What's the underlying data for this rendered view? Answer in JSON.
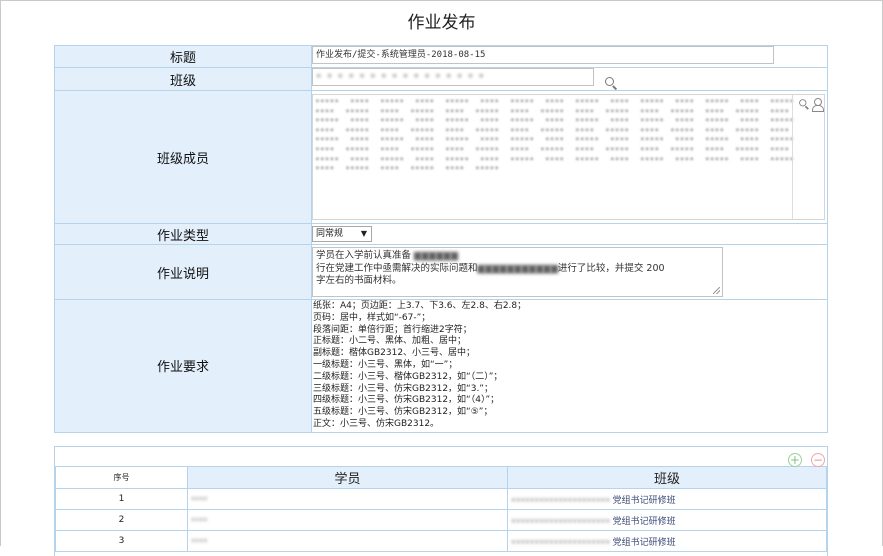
{
  "page": {
    "title": "作业发布"
  },
  "form": {
    "title_label": "标题",
    "title_value": "作业发布/提交-系统管理员-2018-08-15",
    "class_label": "班级",
    "class_value": "• • • • • • • • • • • • • • • •",
    "members_label": "班级成员",
    "members_value": "••••• •••• ••••• •••• ••••• •••• ••••• •••• ••••• •••• ••••• •••• ••••• •••• ••••• •••• ••••• •••• ••••• •••• ••••• •••• ••••• •••• ••••• •••• ••••• •••• ••••• •••• ••••• •••• ••••• •••• ••••• •••• ••••• •••• ••••• •••• ••••• •••• ••••• •••• ••••• •••• ••••• •••• ••••• •••• ••••• •••• ••••• •••• ••••• •••• ••••• •••• ••••• •••• ••••• •••• ••••• •••• ••••• •••• ••••• •••• ••••• •••• ••••• •••• ••••• •••• ••••• •••• ••••• •••• ••••• •••• ••••• •••• ••••• •••• ••••• •••• ••••• •••• ••••• •••• ••••• •••• ••••• •••• ••••• •••• ••••• •••• ••••• •••• ••••• •••• ••••• •••• ••••• •••• ••••• •••• ••••• •••• •••••",
    "type_label": "作业类型",
    "type_value": "同常规",
    "desc_label": "作业说明",
    "desc_line1": "学员在入学前认真准备",
    "desc_line2": "行在党建工作中亟需解决的实际问题和",
    "desc_line2_tail": "进行了比较，并提交 200",
    "desc_line3": "字左右的书面材料。",
    "req_label": "作业要求",
    "req_lines": [
      "纸张：A4；页边距：上3.7、下3.6、左2.8、右2.8；",
      "页码：居中，样式如“-67-”；",
      "段落间距：单倍行距；首行缩进2字符；",
      "正标题：小二号、黑体、加粗、居中；",
      "副标题：楷体GB2312、小三号、居中；",
      "一级标题：小三号、黑体，如“一”；",
      "二级标题：小三号、楷体GB2312，如“（二）”；",
      "三级标题：小三号、仿宋GB2312，如“3.”；",
      "四级标题：小三号、仿宋GB2312，如“（4）”；",
      "五级标题：小三号、仿宋GB2312，如“⑤”；",
      "正文：小三号、仿宋GB2312。"
    ]
  },
  "list": {
    "add_symbol": "+",
    "remove_symbol": "−",
    "col_index": "序号",
    "col_student": "学员",
    "col_class": "班级",
    "rows": [
      {
        "index": "1",
        "student": "••••",
        "class_blur": "•••••••••••••••••••••",
        "class_tail": "党组书记研修班"
      },
      {
        "index": "2",
        "student": "••••",
        "class_blur": "•••••••••••••••••••••",
        "class_tail": "党组书记研修班"
      },
      {
        "index": "3",
        "student": "••••",
        "class_blur": "•••••••••••••••••••••",
        "class_tail": "党组书记研修班"
      }
    ]
  }
}
